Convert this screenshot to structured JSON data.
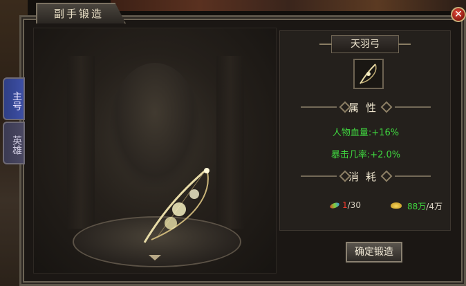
{
  "window": {
    "title": "副手锻造",
    "close_icon": "close-icon"
  },
  "side_tabs": [
    {
      "label": "主号",
      "active": true
    },
    {
      "label": "英雄",
      "active": false
    }
  ],
  "item": {
    "name": "天羽弓",
    "icon": "bow-icon"
  },
  "attributes": {
    "header": "属性",
    "lines": [
      "人物血量:+16%",
      "暴击几率:+2.0%"
    ]
  },
  "cost": {
    "header": "消耗",
    "gem": {
      "icon": "gem-icon",
      "have": "1",
      "need": "/30"
    },
    "gold": {
      "icon": "gold-ingot-icon",
      "have": "88万",
      "need": "/4万"
    }
  },
  "actions": {
    "forge_label": "确定锻造"
  },
  "colors": {
    "attribute_green": "#3fd63f",
    "insufficient_red": "#f03a2c",
    "active_tab_blue": "#3d4fa5"
  }
}
